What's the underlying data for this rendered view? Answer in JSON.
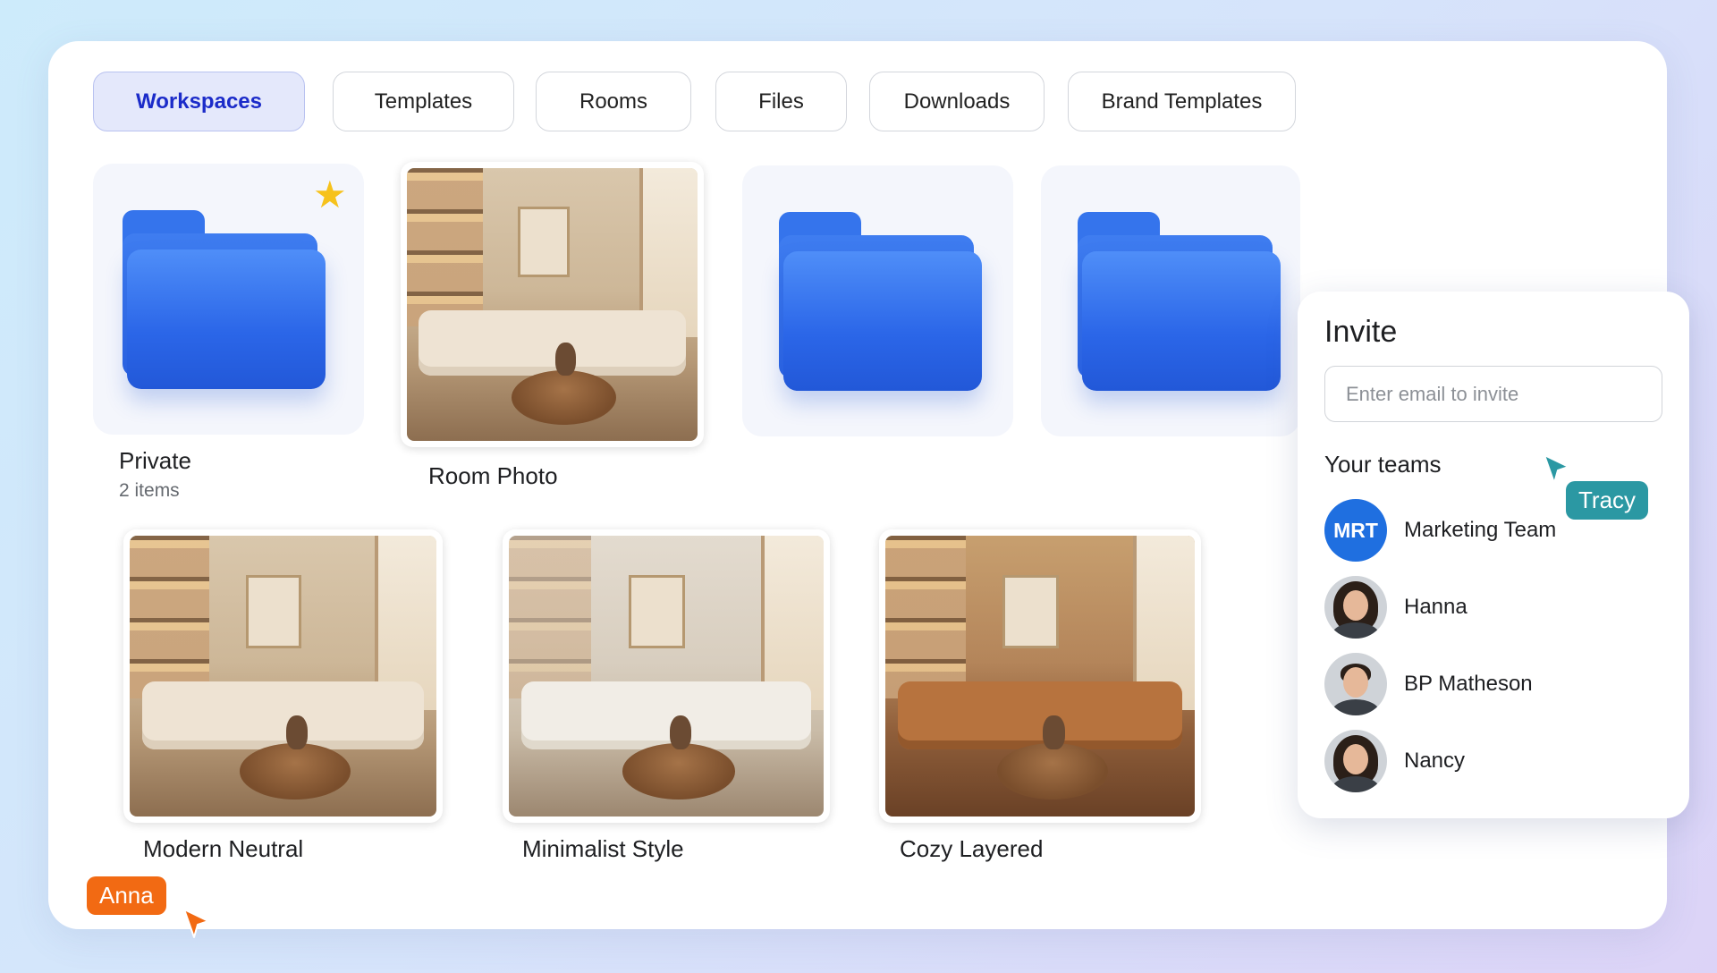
{
  "tabs": [
    {
      "label": "Workspaces",
      "active": true
    },
    {
      "label": "Templates",
      "active": false
    },
    {
      "label": "Rooms",
      "active": false
    },
    {
      "label": "Files",
      "active": false
    },
    {
      "label": "Downloads",
      "active": false
    },
    {
      "label": "Brand Templates",
      "active": false
    }
  ],
  "items": {
    "private": {
      "title": "Private",
      "subtitle": "2 items",
      "starred": true
    },
    "room_photo": {
      "title": "Room Photo"
    },
    "modern_neutral": {
      "title": "Modern Neutral"
    },
    "minimalist_style": {
      "title": "Minimalist Style"
    },
    "cozy_layered": {
      "title": "Cozy Layered"
    }
  },
  "invite": {
    "title": "Invite",
    "email_placeholder": "Enter email to invite",
    "teams_label": "Your teams",
    "members": [
      {
        "initials": "MRT",
        "name": "Marketing Team",
        "type": "team"
      },
      {
        "name": "Hanna",
        "type": "person"
      },
      {
        "name": "BP Matheson",
        "type": "person"
      },
      {
        "name": "Nancy",
        "type": "person"
      }
    ]
  },
  "cursors": {
    "tracy": {
      "name": "Tracy",
      "color": "#2b98a3"
    },
    "anna": {
      "name": "Anna",
      "color": "#f26a13"
    }
  },
  "colors": {
    "accent": "#1b2bc9",
    "folder_blue": "#2b66e8",
    "team_avatar": "#1f6fe0"
  }
}
